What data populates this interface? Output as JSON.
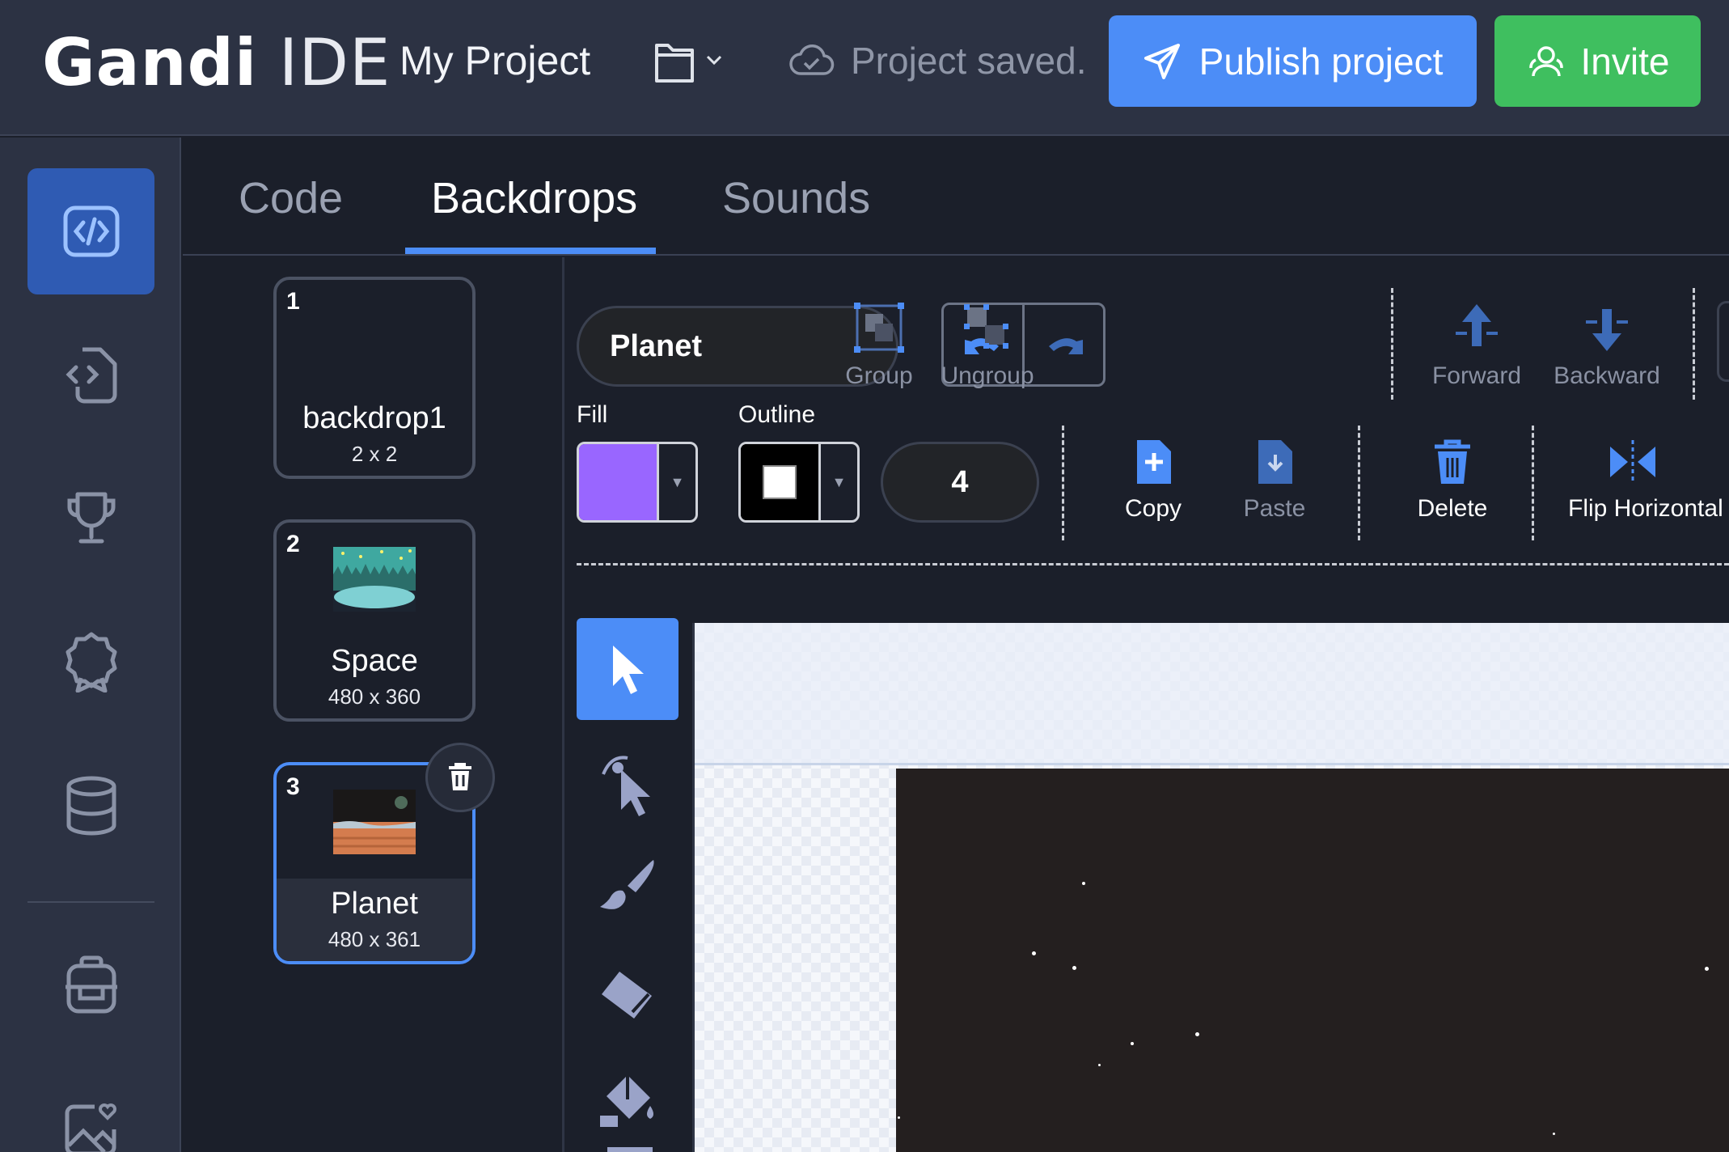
{
  "header": {
    "logo_bold": "Gandi",
    "logo_light": "IDE",
    "project_name": "My Project",
    "save_status": "Project saved.",
    "publish_label": "Publish project",
    "invite_label": "Invite"
  },
  "tabs": [
    {
      "label": "Code"
    },
    {
      "label": "Backdrops"
    },
    {
      "label": "Sounds"
    }
  ],
  "active_tab": "Backdrops",
  "backdrops": [
    {
      "number": "1",
      "name": "backdrop1",
      "size": "2 x 2"
    },
    {
      "number": "2",
      "name": "Space",
      "size": "480 x 360"
    },
    {
      "number": "3",
      "name": "Planet",
      "size": "480 x 361"
    }
  ],
  "paint_editor": {
    "costume_name": "Planet",
    "toolbar": {
      "group": "Group",
      "ungroup": "Ungroup",
      "forward": "Forward",
      "backward": "Backward",
      "copy": "Copy",
      "paste": "Paste",
      "delete": "Delete",
      "flip_horizontal": "Flip Horizontal"
    },
    "fill_label": "Fill",
    "outline_label": "Outline",
    "fill_color": "#9966ff",
    "outline_color": "#000000",
    "outline_width": "4"
  },
  "colors": {
    "accent": "#4c8df7",
    "invite_green": "#3fbf5f",
    "topbar": "#2c3243",
    "background": "#1b1f2a"
  },
  "icons": {
    "rail": [
      "code-editor-icon",
      "extension-icon",
      "trophy-icon",
      "badge-icon",
      "database-icon",
      "backpack-icon",
      "favorite-image-icon"
    ],
    "tools": [
      "select-icon",
      "reshape-icon",
      "brush-icon",
      "eraser-icon",
      "fill-icon"
    ]
  }
}
